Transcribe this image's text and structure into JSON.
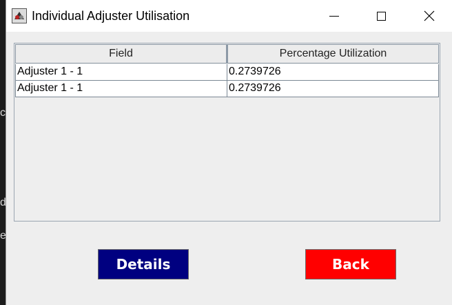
{
  "window": {
    "title": "Individual Adjuster Utilisation",
    "icon": "java-app-icon"
  },
  "table": {
    "columns": [
      "Field",
      "Percentage Utilization"
    ],
    "rows": [
      [
        "Adjuster 1 - 1",
        "0.2739726"
      ],
      [
        "Adjuster 1 - 1",
        "0.2739726"
      ]
    ]
  },
  "buttons": {
    "details_label": "Details",
    "back_label": "Back"
  },
  "colors": {
    "details": "#000080",
    "back": "#ff0000"
  }
}
